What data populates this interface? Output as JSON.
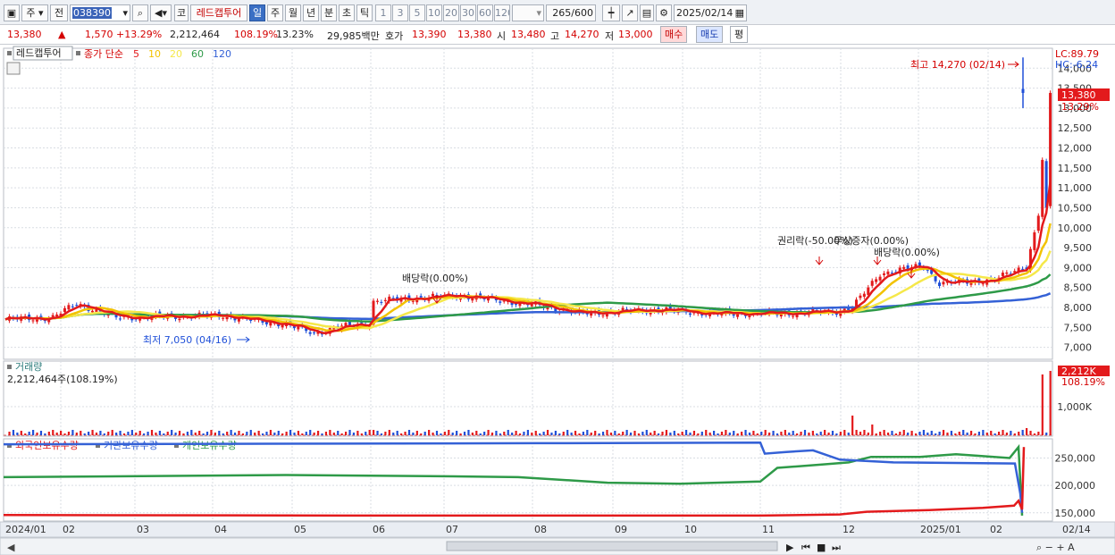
{
  "toolbar": {
    "market": "주",
    "prev": "전",
    "code": "038390",
    "name_prefix": "코",
    "name": "레드캡투어",
    "periods": [
      "일",
      "주",
      "월",
      "년",
      "분",
      "초",
      "틱"
    ],
    "active_period": "일",
    "intervals": [
      "1",
      "3",
      "5",
      "10",
      "20",
      "30",
      "60",
      "120"
    ],
    "count": "265",
    "count_total": "/600",
    "date": "2025/02/14"
  },
  "info": {
    "price": "13,380",
    "arrow": "▲",
    "change": "1,570",
    "change_pct": "+13.29%",
    "volume": "2,212,464",
    "volume_ratio": "108.19%",
    "turnover": "13.23%",
    "amount": "29,985백만",
    "quote_label": "호가",
    "ask": "13,390",
    "bid": "13,380",
    "open_label": "시",
    "open": "13,480",
    "high_label": "고",
    "high": "14,270",
    "low_label": "저",
    "low": "13,000",
    "buy": "매수",
    "sell": "매도",
    "flat": "평"
  },
  "price_panel": {
    "name_tag": "레드캡투어",
    "ma_label": "종가 단순",
    "ma_periods": [
      "5",
      "10",
      "20",
      "60",
      "120"
    ],
    "ma_colors": [
      "#e31a1c",
      "#f2c200",
      "#f5e84a",
      "#2e9a48",
      "#3461d6"
    ],
    "lc": "LC:89.79",
    "hc": "HC:-6.24",
    "price_tag": "13,380",
    "pct_tag": "13.29%",
    "y_ticks": [
      "14,000",
      "13,500",
      "13,000",
      "12,500",
      "12,000",
      "11,500",
      "11,000",
      "10,500",
      "10,000",
      "9,500",
      "9,000",
      "8,500",
      "8,000",
      "7,500",
      "7,000"
    ],
    "y_values": [
      14000,
      13500,
      13000,
      12500,
      12000,
      11500,
      11000,
      10500,
      10000,
      9500,
      9000,
      8500,
      8000,
      7500,
      7000
    ],
    "high_annot": "최고 14,270 (02/14)",
    "low_annot": "최저 7,050 (04/16)",
    "events": [
      "배당락(0.00%)",
      "권리락(-50.00%)",
      "무상증자(0.00%)",
      "배당락(0.00%)"
    ]
  },
  "volume_panel": {
    "title": "거래량",
    "value": "2,212,464주(108.19%)",
    "tag": "2,212K",
    "tag_pct": "108.19%",
    "tick": "1,000K"
  },
  "holding_panel": {
    "legend": [
      "외국인보유수량",
      "기관보유수량",
      "개인보유수량"
    ],
    "legend_colors": [
      "#e31a1c",
      "#3461d6",
      "#2e9a48"
    ],
    "ticks": [
      "250,000",
      "200,000",
      "150,000"
    ]
  },
  "x_labels": [
    "2024/01",
    "02",
    "03",
    "04",
    "05",
    "06",
    "07",
    "08",
    "09",
    "10",
    "11",
    "12",
    "2025/01",
    "02",
    "02/14"
  ],
  "colors": {
    "up": "#e31a1c",
    "down": "#1f4fd8",
    "grid": "#d9dde3"
  }
}
